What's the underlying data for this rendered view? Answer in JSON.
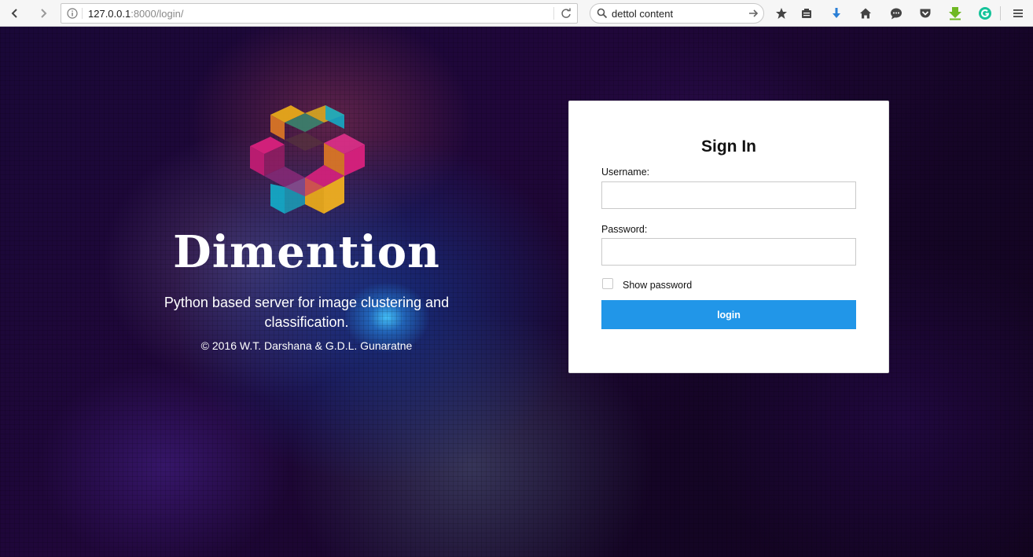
{
  "browser": {
    "url_host": "127.0.0.1",
    "url_path": ":8000/login/",
    "search_value": "dettol content",
    "icons": [
      "back-icon",
      "forward-icon",
      "info-icon",
      "reload-icon",
      "search-icon",
      "go-arrow-icon",
      "bookmark-star-icon",
      "reading-list-icon",
      "downloads-icon",
      "home-icon",
      "chat-icon",
      "pocket-icon",
      "download-helper-icon",
      "grammarly-icon",
      "menu-icon"
    ]
  },
  "brand": {
    "name": "Dimention",
    "tagline": "Python based server for image clustering and classification.",
    "copyright": "© 2016 W.T. Darshana & G.D.L. Gunaratne"
  },
  "signin": {
    "title": "Sign In",
    "username_label": "Username:",
    "username_value": "",
    "password_label": "Password:",
    "password_value": "",
    "show_password_label": "Show password",
    "show_password_checked": false,
    "login_label": "login"
  },
  "colors": {
    "accent": "#2196e8",
    "logo": [
      "#e8a91a",
      "#d9217d",
      "#14a8c4",
      "#f0b020"
    ]
  }
}
